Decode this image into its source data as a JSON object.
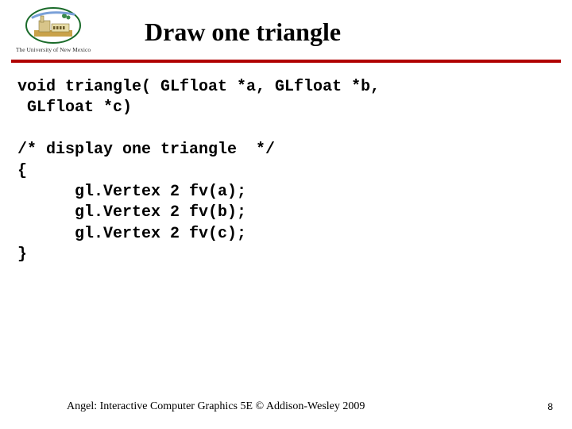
{
  "header": {
    "logo_caption": "The University of New Mexico",
    "title": "Draw one triangle"
  },
  "code": {
    "line1": "void triangle( GLfloat *a, GLfloat *b,",
    "line2": " GLfloat *c)",
    "blank1": "",
    "line3": "/* display one triangle  */",
    "line4": "{",
    "line5": "      gl.Vertex 2 fv(a);",
    "line6": "      gl.Vertex 2 fv(b);",
    "line7": "      gl.Vertex 2 fv(c);",
    "line8": "}"
  },
  "footer": {
    "credit": "Angel: Interactive Computer Graphics 5E © Addison-Wesley 2009",
    "page": "8"
  }
}
